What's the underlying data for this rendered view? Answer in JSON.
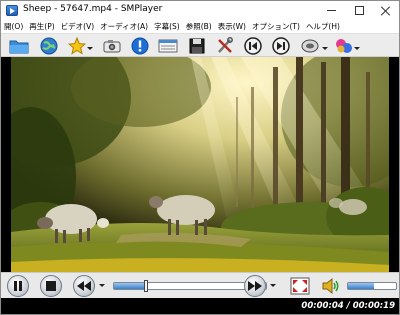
{
  "window": {
    "title": "Sheep - 57647.mp4 - SMPlayer"
  },
  "menu": [
    "開(O)",
    "再生(P)",
    "ビデオ(V)",
    "オーディオ(A)",
    "字幕(S)",
    "参照(B)",
    "表示(W)",
    "オプション(T)",
    "ヘルプ(H)"
  ],
  "toolbar": {
    "icons": [
      "open-folder-icon",
      "globe-icon",
      "favorites-star-icon",
      "screenshot-camera-icon",
      "info-icon",
      "playlist-icon",
      "save-floppy-icon",
      "preferences-tools-icon",
      "previous-icon",
      "next-icon",
      "audio-track-icon",
      "subtitles-icon"
    ]
  },
  "playback": {
    "progress_fraction": 0.21,
    "volume_fraction": 0.55,
    "time_text": "00:00:04 / 00:00:19"
  },
  "colors": {
    "accent": "#3a7fc9",
    "status_bg": "#000000",
    "time_text": "#ffffff"
  }
}
